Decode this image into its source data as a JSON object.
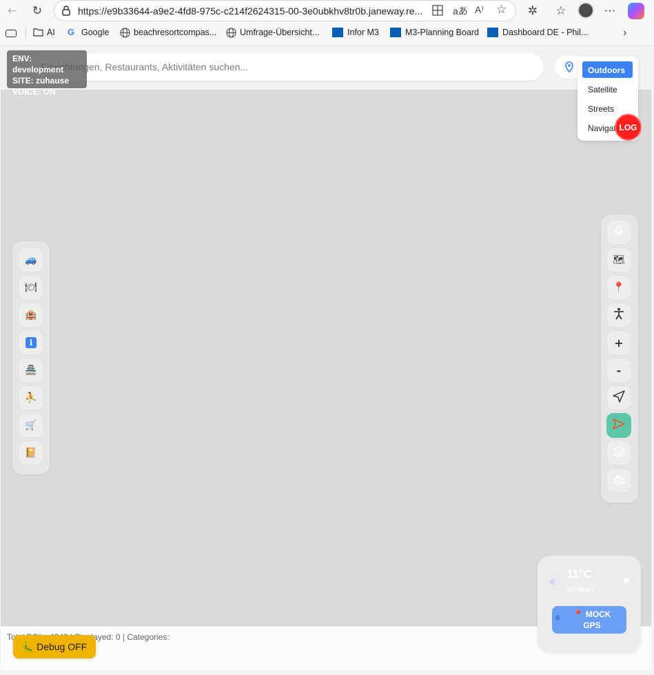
{
  "browser": {
    "url": "https://e9b33644-a9e2-4fd8-975c-c214f2624315-00-3e0ubkhv8tr0b.janeway.re...",
    "bookmarks": [
      {
        "label": "AI",
        "icon": "folder-icon"
      },
      {
        "label": "Google",
        "icon": "google-icon"
      },
      {
        "label": "beachresortcompas...",
        "icon": "globe-icon"
      },
      {
        "label": "Umfrage-Übersicht...",
        "icon": "globe-icon"
      },
      {
        "label": "Infor M3",
        "icon": "infor-icon"
      },
      {
        "label": "M3-Planning Board",
        "icon": "infor-icon"
      },
      {
        "label": "Dashboard DE - Phil...",
        "icon": "infor-icon"
      }
    ]
  },
  "env": {
    "env": "ENV: development",
    "site": "SITE: zuhause",
    "voice": "VOICE: ON"
  },
  "search": {
    "placeholder": "Einrichtungen, Restaurants, Aktivitäten suchen..."
  },
  "map_styles": {
    "items": [
      "Outdoors",
      "Satellite",
      "Streets",
      "Navigation"
    ],
    "active": "Outdoors"
  },
  "log_button": "LOG",
  "left_panel": {
    "items": [
      {
        "icon": "car-icon",
        "glyph": "🚙"
      },
      {
        "icon": "restaurant-icon",
        "glyph": "🍽"
      },
      {
        "icon": "hotel-icon",
        "glyph": "🏨"
      },
      {
        "icon": "info-icon",
        "glyph": "ℹ"
      },
      {
        "icon": "temple-icon",
        "glyph": "🏯"
      },
      {
        "icon": "activity-icon",
        "glyph": "⛹"
      },
      {
        "icon": "shopping-cart-icon",
        "glyph": "🛒"
      },
      {
        "icon": "book-icon",
        "glyph": "📔"
      }
    ]
  },
  "right_panel": {
    "items": [
      {
        "icon": "microphone-icon",
        "glyph": "🎙"
      },
      {
        "icon": "map-icon",
        "glyph": "🗺"
      },
      {
        "icon": "pin-icon",
        "glyph": "📍"
      },
      {
        "icon": "accessibility-icon",
        "glyph": "♿"
      },
      {
        "icon": "zoom-in-icon",
        "glyph": "+"
      },
      {
        "icon": "zoom-out-icon",
        "glyph": "-"
      },
      {
        "icon": "navigate-icon",
        "glyph": "➤"
      },
      {
        "icon": "send-icon",
        "glyph": "➢"
      },
      {
        "icon": "layers-icon",
        "glyph": "◈"
      },
      {
        "icon": "bug-icon",
        "glyph": "🐞"
      }
    ]
  },
  "weather": {
    "temperature": "11°C",
    "description": "Wolken",
    "mock_gps": "📍 MOCK GPS"
  },
  "stats": "Total POIs: 4940 | Displayed: 0 | Categories:",
  "debug_button": "🐛 Debug OFF",
  "colors": {
    "accent": "#3b82f6",
    "log": "#ff1f1f",
    "debug": "#f0b400",
    "mock_gps": "#6b9ff6",
    "send_button": "#5cc6a8"
  }
}
